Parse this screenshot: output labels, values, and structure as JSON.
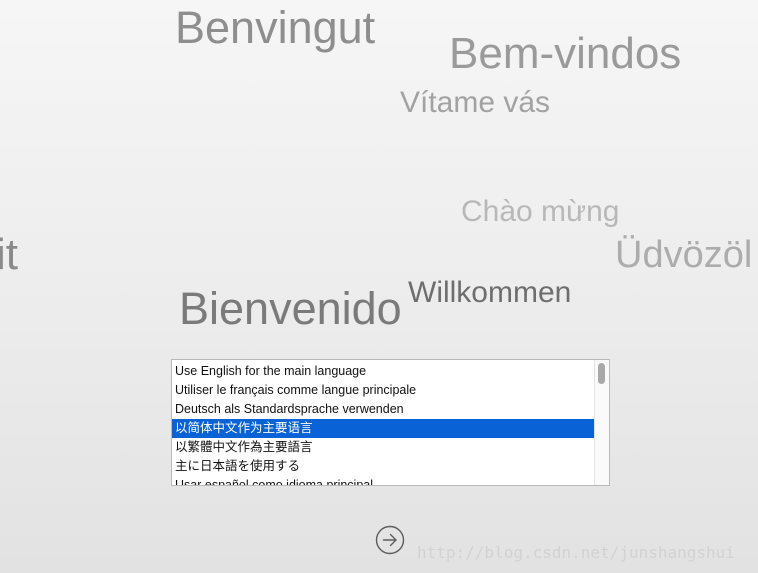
{
  "greetings": {
    "benvingut": "Benvingut",
    "bem_vindos": "Bem-vindos",
    "vitame_vas": "Vítame vás",
    "chao_mung": "Chào mừng",
    "udvozol": "Üdvözöl",
    "partial_it": "it",
    "bienvenido": "Bienvenido",
    "willkommen": "Willkommen"
  },
  "language_list": {
    "items": [
      "Use English for the main language",
      "Utiliser le français comme langue principale",
      "Deutsch als Standardsprache verwenden",
      "以简体中文作为主要语言",
      "以繁體中文作為主要語言",
      "主に日本語を使用する",
      "Usar español como idioma principal"
    ],
    "selected_index": 3
  },
  "next_button": {
    "icon": "arrow-right-circle-icon"
  },
  "watermark": "http://blog.csdn.net/junshangshui"
}
